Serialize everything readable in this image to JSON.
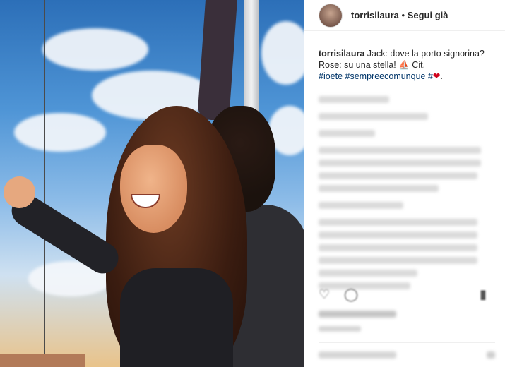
{
  "post": {
    "username": "torrisilaura",
    "separator": " • ",
    "follow_label": "Segui già"
  },
  "caption": {
    "username": "torrisilaura",
    "line1": " Jack: dove la porto signorina?",
    "line2": "Rose: su una stella! ⛵ Cit.",
    "hashtags": "#ioete #sempreecomunque #",
    "heart": "❤",
    "end": "."
  },
  "icons": {
    "like": "heart-outline-icon",
    "comment": "comment-bubble-icon",
    "save": "bookmark-icon"
  }
}
